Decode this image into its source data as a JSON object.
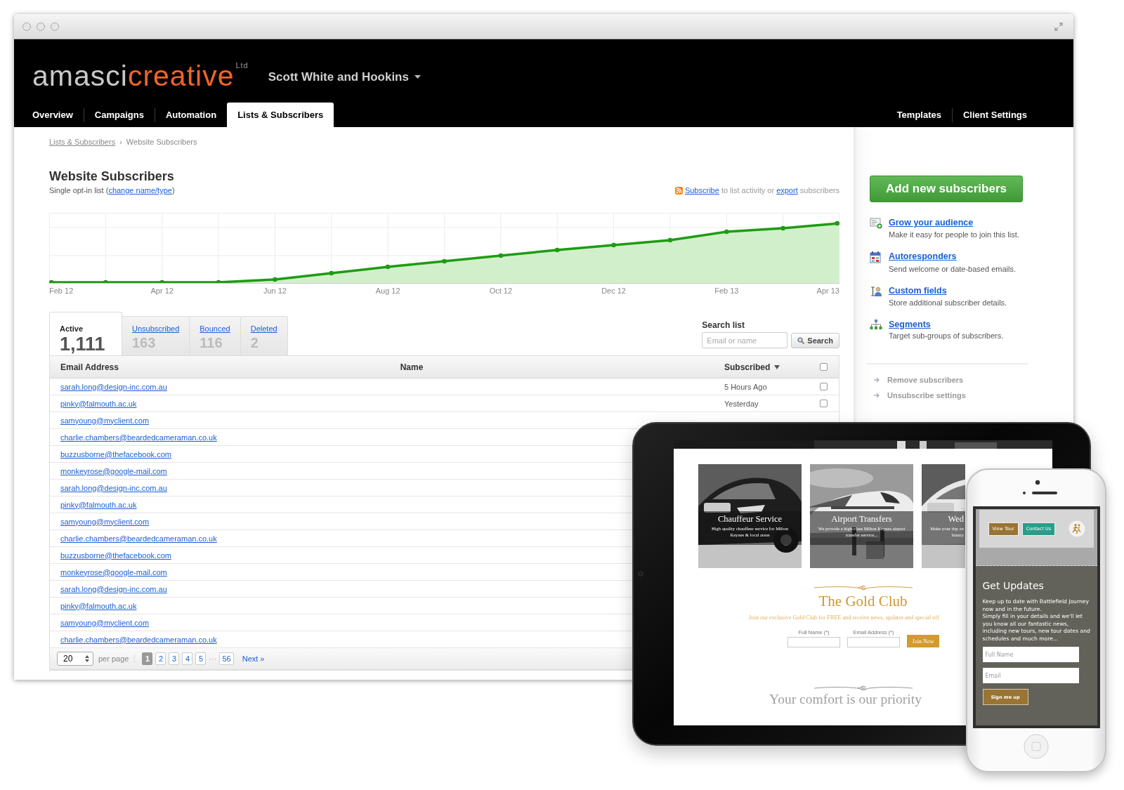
{
  "header": {
    "logo": {
      "first": "amasci",
      "second": "creative",
      "suffix": "Ltd"
    },
    "client": "Scott White and Hookins"
  },
  "nav": {
    "left": [
      {
        "label": "Overview",
        "selected": false
      },
      {
        "label": "Campaigns",
        "selected": false
      },
      {
        "label": "Automation",
        "selected": false
      },
      {
        "label": "Lists & Subscribers",
        "selected": true
      }
    ],
    "right": [
      {
        "label": "Templates",
        "selected": false
      },
      {
        "label": "Client Settings",
        "selected": false
      }
    ]
  },
  "breadcrumb": {
    "link": "Lists & Subscribers",
    "separator": "›",
    "current": "Website Subscribers"
  },
  "list": {
    "title": "Website Subscribers",
    "subtitle": {
      "text": "Single opt-in list (",
      "link": "change name/type",
      "end": ")"
    },
    "activity": {
      "link": "Subscribe",
      "text": "to list activity or",
      "link2": "export",
      "end": "subscribers"
    }
  },
  "chart": {
    "x_labels": [
      "Feb 12",
      "Apr 12",
      "Jun 12",
      "Aug 12",
      "Oct 12",
      "Dec 12",
      "Feb 13",
      "Apr 13"
    ]
  },
  "tabs": [
    {
      "label": "Active",
      "count": "1,111",
      "selected": true
    },
    {
      "label": "Unsubscribed",
      "count": "163",
      "selected": false
    },
    {
      "label": "Bounced",
      "count": "116",
      "selected": false
    },
    {
      "label": "Deleted",
      "count": "2",
      "selected": false
    }
  ],
  "search": {
    "label": "Search list",
    "placeholder": "Email or name",
    "button": "Search"
  },
  "table": {
    "columns": [
      "Email Address",
      "Name",
      "Subscribed"
    ],
    "select_all_checked": false,
    "rows": [
      {
        "email": "sarah.long@design-inc.com.au",
        "subscribed": "5 Hours Ago",
        "checked": false
      },
      {
        "email": "pinky@falmouth.ac.uk",
        "subscribed": "Yesterday",
        "checked": false
      },
      {
        "email": "samyoung@myclient.com"
      },
      {
        "email": "charlie.chambers@beardedcameraman.co.uk"
      },
      {
        "email": "buzzusborne@thefacebook.com"
      },
      {
        "email": "monkeyrose@google-mail.com"
      },
      {
        "email": "sarah.long@design-inc.com.au"
      },
      {
        "email": "pinky@falmouth.ac.uk"
      },
      {
        "email": "samyoung@myclient.com"
      },
      {
        "email": "charlie.chambers@beardedcameraman.co.uk"
      },
      {
        "email": "buzzusborne@thefacebook.com"
      },
      {
        "email": "monkeyrose@google-mail.com"
      },
      {
        "email": "sarah.long@design-inc.com.au"
      },
      {
        "email": "pinky@falmouth.ac.uk"
      },
      {
        "email": "samyoung@myclient.com"
      },
      {
        "email": "charlie.chambers@beardedcameraman.co.uk"
      }
    ]
  },
  "pagination": {
    "per_page": "20",
    "per_page_label": "per page",
    "pages": [
      {
        "label": "1",
        "selected": true
      },
      {
        "label": "2",
        "selected": false
      },
      {
        "label": "3",
        "selected": false
      },
      {
        "label": "4",
        "selected": false
      },
      {
        "label": "5",
        "selected": false
      }
    ],
    "ellipsis": "···",
    "last_page": {
      "label": "56",
      "selected": false
    },
    "next": "Next »"
  },
  "sidebar": {
    "button": "Add new subscribers",
    "features": [
      {
        "kind": "grow",
        "title": "Grow your audience",
        "description": "Make it easy for people to join this list."
      },
      {
        "kind": "calendar",
        "title": "Autoresponders",
        "description": "Send welcome or date-based emails."
      },
      {
        "kind": "fields",
        "title": "Custom fields",
        "description": "Store additional subscriber details."
      },
      {
        "kind": "segments",
        "title": "Segments",
        "description": "Target sub-groups of subscribers."
      }
    ],
    "links": [
      "Remove subscribers",
      "Unsubscribe settings"
    ]
  },
  "tablet": {
    "cards": [
      {
        "title": "Chauffeur Service",
        "lines": [
          "High quality chauffeur service for Milton",
          "Keynes & local areas"
        ]
      },
      {
        "title": "Airport Transfers",
        "lines": [
          "We provide a high-class Milton Keynes airport",
          "transfer service..."
        ]
      },
      {
        "title": "Wed",
        "lines": [
          "Make your day ex",
          "luxury"
        ]
      }
    ],
    "club": {
      "title": "The Gold Club",
      "text": "Join our exclusive Gold Club for FREE and receive news, updates and special off",
      "fields": [
        "Full Name (*)",
        "Email Address (*)"
      ],
      "button": "Join Now"
    },
    "tagline": "Your comfort is our priority"
  },
  "phone": {
    "buttons": [
      {
        "label": "View Tour",
        "color": "#9a7433"
      },
      {
        "label": "Contact Us",
        "color": "#2a9d8a"
      }
    ],
    "title": "Get Updates",
    "paragraphs": [
      "Keep up to date with Battlefield Journey now and in the future.",
      "Simply fill in your details and we'll let you know all our fantastic news, including new tours, new tour dates and schedules and much more..."
    ],
    "fields": [
      {
        "placeholder": "Full Name"
      },
      {
        "placeholder": "Email"
      }
    ],
    "button": "Sign me up"
  }
}
